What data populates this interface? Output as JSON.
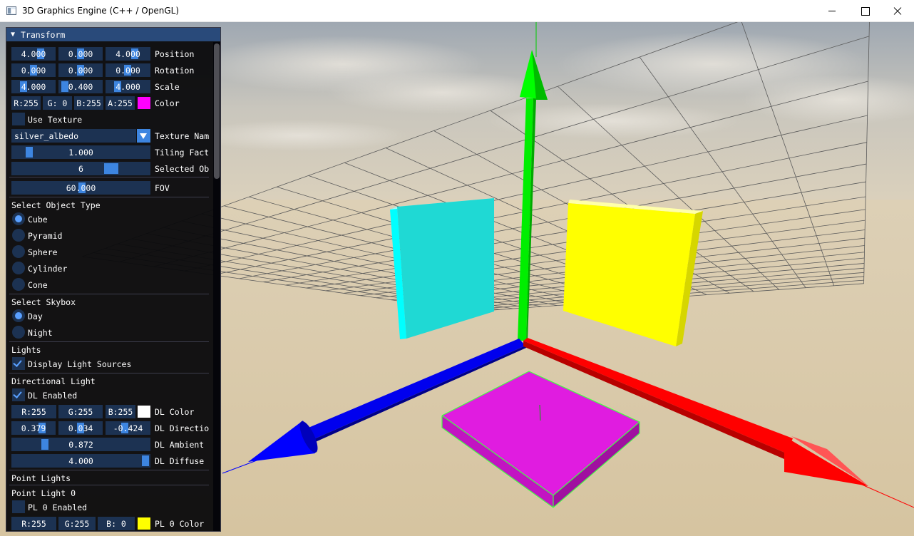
{
  "window": {
    "title": "3D Graphics Engine (C++ / OpenGL)",
    "controls": [
      "minimize",
      "maximize",
      "close"
    ]
  },
  "panel": {
    "header": "Transform",
    "transform": {
      "position": {
        "label": "Position",
        "values": [
          "4.000",
          "0.000",
          "4.000"
        ]
      },
      "rotation": {
        "label": "Rotation",
        "values": [
          "0.000",
          "0.000",
          "0.000"
        ]
      },
      "scale": {
        "label": "Scale",
        "values": [
          "4.000",
          "0.400",
          "4.000"
        ]
      },
      "color": {
        "label": "Color",
        "r": "R:255",
        "g": "G:  0",
        "b": "B:255",
        "a": "A:255",
        "swatch": "#ff00ff"
      },
      "use_texture": {
        "label": "Use Texture",
        "checked": false
      },
      "texture_name": {
        "label": "Texture Nam",
        "value": "silver_albedo"
      },
      "tiling": {
        "label": "Tiling Fact",
        "value": "1.000",
        "fraction": 0.1
      },
      "selected": {
        "label": "Selected Ob",
        "value": "6",
        "fraction": 0.75
      },
      "fov": {
        "label": "FOV",
        "value": "60.000",
        "fraction": 0.5
      }
    },
    "object_type": {
      "heading": "Select Object Type",
      "options": [
        "Cube",
        "Pyramid",
        "Sphere",
        "Cylinder",
        "Cone"
      ],
      "selected": "Cube"
    },
    "skybox": {
      "heading": "Select Skybox",
      "options": [
        "Day",
        "Night"
      ],
      "selected": "Day"
    },
    "lights": {
      "heading": "Lights",
      "display_sources": {
        "label": "Display Light Sources",
        "checked": true
      }
    },
    "directional": {
      "heading": "Directional Light",
      "enabled": {
        "label": "DL Enabled",
        "checked": true
      },
      "color": {
        "label": "DL Color",
        "r": "R:255",
        "g": "G:255",
        "b": "B:255",
        "swatch": "#ffffff"
      },
      "direction": {
        "label": "DL Directio",
        "values": [
          "0.379",
          "0.034",
          "-0.424"
        ]
      },
      "ambient": {
        "label": "DL Ambient",
        "value": "0.872",
        "fraction": 0.2
      },
      "diffuse": {
        "label": "DL Diffuse",
        "value": "4.000",
        "fraction": 1.0
      }
    },
    "point_lights": {
      "heading": "Point Lights",
      "light0": {
        "heading": "Point Light 0",
        "enabled": {
          "label": "PL 0 Enabled",
          "checked": false
        },
        "color": {
          "label": "PL 0 Color",
          "r": "R:255",
          "g": "G:255",
          "b": "B:  0",
          "swatch": "#ffff00"
        }
      }
    }
  },
  "scene": {
    "colors": {
      "x_axis": "#ff0000",
      "y_axis": "#00ff00",
      "z_axis": "#0000ff",
      "cyan_cube": "#1fd9d4",
      "yellow_cube": "#ffff00",
      "magenta_cube": "#e01ce0",
      "grid_line": "#555555",
      "ground": "#d8c8a8"
    }
  }
}
